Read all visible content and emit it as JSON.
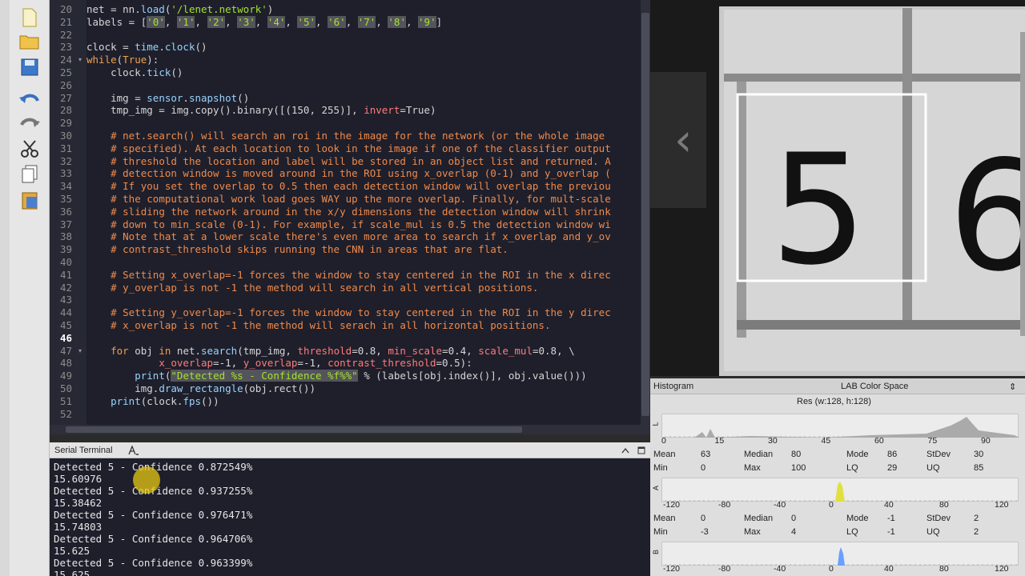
{
  "editor": {
    "lines": [
      {
        "n": "20",
        "html": "net = nn.<span class=\"fn\">load</span>(<span class=\"str\">'/lenet.network'</span>)"
      },
      {
        "n": "21",
        "html": "labels = [<span class=\"str mark\">'0'</span>, <span class=\"str mark\">'1'</span>, <span class=\"str mark\">'2'</span>, <span class=\"str mark\">'3'</span>, <span class=\"str mark\">'4'</span>, <span class=\"str mark\">'5'</span>, <span class=\"str mark\">'6'</span>, <span class=\"str mark\">'7'</span>, <span class=\"str mark\">'8'</span>, <span class=\"str mark\">'9'</span>]"
      },
      {
        "n": "22",
        "html": ""
      },
      {
        "n": "23",
        "html": "clock = <span class=\"fn\">time</span>.<span class=\"fn\">clock</span>()"
      },
      {
        "n": "24",
        "html": "<span class=\"kw\">while</span>(<span class=\"kw\">True</span>):",
        "fold": true
      },
      {
        "n": "25",
        "html": "    clock.<span class=\"fn\">tick</span>()"
      },
      {
        "n": "26",
        "html": ""
      },
      {
        "n": "27",
        "html": "    img = <span class=\"fn\">sensor</span>.<span class=\"fn\">snapshot</span>()"
      },
      {
        "n": "28",
        "html": "    tmp_img = img.copy().binary([(150, 255)], <span class=\"param\">invert</span>=True)"
      },
      {
        "n": "29",
        "html": ""
      },
      {
        "n": "30",
        "html": "    <span class=\"com\"># net.search() will search an roi in the image for the network (or the whole image</span>"
      },
      {
        "n": "31",
        "html": "    <span class=\"com\"># specified). At each location to look in the image if one of the classifier output</span>"
      },
      {
        "n": "32",
        "html": "    <span class=\"com\"># threshold the location and label will be stored in an object list and returned. A</span>"
      },
      {
        "n": "33",
        "html": "    <span class=\"com\"># detection window is moved around in the ROI using x_overlap (0-1) and y_overlap (</span>"
      },
      {
        "n": "34",
        "html": "    <span class=\"com\"># If you set the overlap to 0.5 then each detection window will overlap the previou</span>"
      },
      {
        "n": "35",
        "html": "    <span class=\"com\"># the computational work load goes WAY up the more overlap. Finally, for mult-scale</span>"
      },
      {
        "n": "36",
        "html": "    <span class=\"com\"># sliding the network around in the x/y dimensions the detection window will shrink</span>"
      },
      {
        "n": "37",
        "html": "    <span class=\"com\"># down to min_scale (0-1). For example, if scale_mul is 0.5 the detection window wi</span>"
      },
      {
        "n": "38",
        "html": "    <span class=\"com\"># Note that at a lower scale there's even more area to search if x_overlap and y_ov</span>"
      },
      {
        "n": "39",
        "html": "    <span class=\"com\"># contrast_threshold skips running the CNN in areas that are flat.</span>"
      },
      {
        "n": "40",
        "html": ""
      },
      {
        "n": "41",
        "html": "    <span class=\"com\"># Setting x_overlap=-1 forces the window to stay centered in the ROI in the x direc</span>"
      },
      {
        "n": "42",
        "html": "    <span class=\"com\"># y_overlap is not -1 the method will search in all vertical positions.</span>"
      },
      {
        "n": "43",
        "html": ""
      },
      {
        "n": "44",
        "html": "    <span class=\"com\"># Setting y_overlap=-1 forces the window to stay centered in the ROI in the y direc</span>"
      },
      {
        "n": "45",
        "html": "    <span class=\"com\"># x_overlap is not -1 the method will serach in all horizontal positions.</span>"
      },
      {
        "n": "46",
        "html": "",
        "current": true
      },
      {
        "n": "47",
        "html": "    <span class=\"kw\">for</span> obj <span class=\"kw\">in</span> net.<span class=\"fn\">search</span>(tmp_img, <span class=\"param\">threshold</span>=0.8, <span class=\"param\">min_scale</span>=0.4, <span class=\"param\">scale_mul</span>=0.8, \\",
        "fold": true
      },
      {
        "n": "48",
        "html": "            <span class=\"param\">x_overlap</span>=-1, <span class=\"param\">y_overlap</span>=-1, <span class=\"param\">contrast_threshold</span>=0.5):"
      },
      {
        "n": "49",
        "html": "        <span class=\"fn\">print</span>(<span class=\"str mark\">\"Detected %s - Confidence %f%%\"</span> % (labels[obj.index()], obj.value()))"
      },
      {
        "n": "50",
        "html": "        img.<span class=\"fn\">draw_rectangle</span>(obj.rect())"
      },
      {
        "n": "51",
        "html": "    <span class=\"fn\">print</span>(clock.<span class=\"fn\">fps</span>())"
      },
      {
        "n": "52",
        "html": ""
      }
    ]
  },
  "terminal": {
    "title": "Serial Terminal",
    "lines": [
      "Detected 5 - Confidence 0.872549%",
      "15.60976",
      "Detected 5 - Confidence 0.937255%",
      "15.38462",
      "Detected 5 - Confidence 0.976471%",
      "15.74803",
      "Detected 5 - Confidence 0.964706%",
      "15.625",
      "Detected 5 - Confidence 0.963399%",
      "15.625"
    ]
  },
  "histogram": {
    "title": "Histogram",
    "color_space": "LAB Color Space",
    "resolution": "Res (w:128, h:128)",
    "channels": [
      {
        "name": "L",
        "color": "#aaaaaa",
        "ticks": [
          "0",
          "15",
          "30",
          "45",
          "60",
          "75",
          "90"
        ],
        "stats": {
          "Mean": "63",
          "Median": "80",
          "Mode": "86",
          "StDev": "30",
          "Min": "0",
          "Max": "100",
          "LQ": "29",
          "UQ": "85"
        }
      },
      {
        "name": "A",
        "color": "#e0e040",
        "ticks": [
          "-120",
          "-80",
          "-40",
          "0",
          "40",
          "80",
          "120"
        ],
        "stats": {
          "Mean": "0",
          "Median": "0",
          "Mode": "-1",
          "StDev": "2",
          "Min": "-3",
          "Max": "4",
          "LQ": "-1",
          "UQ": "2"
        }
      },
      {
        "name": "B",
        "color": "#6aa0ff",
        "ticks": [
          "-120",
          "-80",
          "-40",
          "0",
          "40",
          "80",
          "120"
        ]
      }
    ]
  }
}
